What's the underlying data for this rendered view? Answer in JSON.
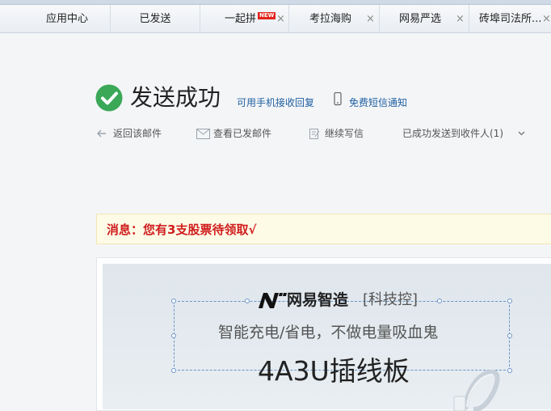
{
  "tabs": [
    {
      "label": "应用中心",
      "closable": false,
      "badge": ""
    },
    {
      "label": "已发送",
      "closable": false,
      "badge": ""
    },
    {
      "label": "一起拼",
      "closable": true,
      "badge": "NEW"
    },
    {
      "label": "考拉海购",
      "closable": true,
      "badge": ""
    },
    {
      "label": "网易严选",
      "closable": true,
      "badge": ""
    },
    {
      "label": "砖埠司法所...",
      "closable": true,
      "badge": ""
    }
  ],
  "close_glyph": "×",
  "result": {
    "title": "发送成功",
    "reply_link": "可用手机接收回复",
    "sms_link": "免费短信通知",
    "status_color": "#3aa857"
  },
  "actions": [
    {
      "label": "返回该邮件",
      "icon": "back-arrow-icon"
    },
    {
      "label": "查看已发邮件",
      "icon": "envelope-icon"
    },
    {
      "label": "继续写信",
      "icon": "compose-icon"
    },
    {
      "label": "已成功发送到收件人(1)",
      "icon": "chevron-down-icon"
    }
  ],
  "message": {
    "text": "消息：您有3支股票待领取√",
    "color": "#d01e1e"
  },
  "ad": {
    "brand_name": "网易智造",
    "brand_tag": "[科技控]",
    "slogan": "智能充电/省电，不做电量吸血鬼",
    "product": "4A3U插线板"
  }
}
